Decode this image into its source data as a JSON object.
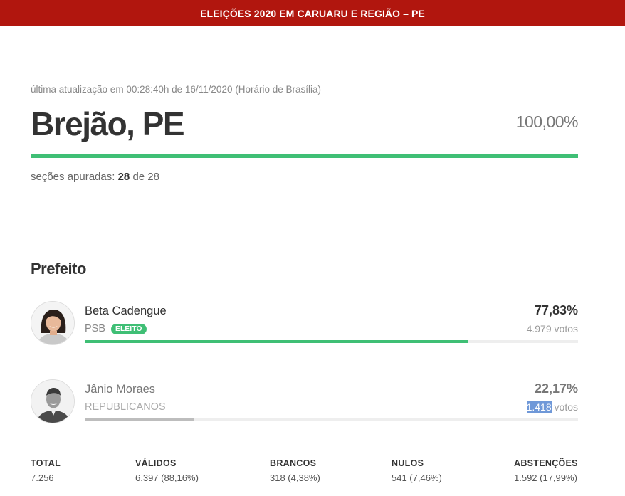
{
  "header": {
    "title": "ELEIÇÕES 2020 EM CARUARU E REGIÃO – PE"
  },
  "status": {
    "updated": "última atualização em 00:28:40h de 16/11/2020 (Horário de Brasília)",
    "city": "Brejão, PE",
    "percent_counted": "100,00%",
    "progress_fraction": 1.0,
    "sections_label": "seções apuradas:",
    "sections_counted": "28",
    "sections_of": "de 28"
  },
  "section_title": "Prefeito",
  "candidates": [
    {
      "name": "Beta Cadengue",
      "party": "PSB",
      "badge": "ELEITO",
      "percent": "77,83%",
      "votes_number": "4.979",
      "votes_suffix": " votos",
      "share": 0.7783,
      "bar_color": "#3fbf75"
    },
    {
      "name": "Jânio Moraes",
      "party": "REPUBLICANOS",
      "percent": "22,17%",
      "votes_number": "1.418",
      "votes_suffix": " votos",
      "share": 0.2217,
      "bar_color": "#bdbdbd"
    }
  ],
  "totals": [
    {
      "label": "TOTAL",
      "value": "7.256"
    },
    {
      "label": "VÁLIDOS",
      "value": "6.397 (88,16%)"
    },
    {
      "label": "BRANCOS",
      "value": "318 (4,38%)"
    },
    {
      "label": "NULOS",
      "value": "541 (7,46%)"
    },
    {
      "label": "ABSTENÇÕES",
      "value": "1.592 (17,99%)"
    }
  ]
}
